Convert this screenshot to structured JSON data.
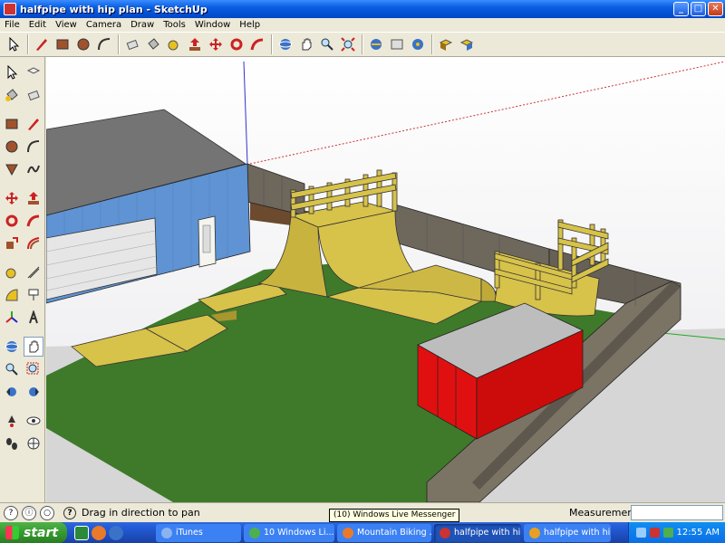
{
  "window": {
    "title": "halfpipe with hip plan - SketchUp",
    "min": "_",
    "max": "□",
    "close": "✕"
  },
  "menu": [
    "File",
    "Edit",
    "View",
    "Camera",
    "Draw",
    "Tools",
    "Window",
    "Help"
  ],
  "toolbar_icons": [
    "select-icon",
    "pencil-icon",
    "rectangle-icon",
    "circle-icon",
    "arc-icon",
    "eraser-icon",
    "paint-bucket-icon",
    "tape-measure-icon",
    "push-pull-icon",
    "move-icon",
    "rotate-icon",
    "follow-me-icon",
    "orbit-icon",
    "pan-icon",
    "zoom-icon",
    "zoom-extents-icon",
    "get-models-icon",
    "share-model-icon",
    "place-model-icon",
    "components-icon",
    "share-component-icon"
  ],
  "status": {
    "hint": "Drag in direction to pan",
    "measurements_label": "Measurements",
    "tooltip": "(10) Windows Live Messenger"
  },
  "taskbar": {
    "start": "start",
    "tasks": [
      {
        "label": "iTunes",
        "color": "#5a8fd8"
      },
      {
        "label": "10 Windows Li...",
        "color": "#4db04d"
      },
      {
        "label": "Mountain Biking ...",
        "color": "#e97a2b"
      },
      {
        "label": "halfpipe with hip...",
        "color": "#c33"
      },
      {
        "label": "halfpipe with hip...",
        "color": "#e8a020"
      }
    ],
    "clock": "12:55 AM"
  },
  "colors": {
    "grass": "#3f7a2a",
    "ramp": "#d7c24a",
    "fence": "#6e675c",
    "house_siding": "#5f93d3",
    "roof": "#777777",
    "container": "#e01010",
    "container_top": "#bdbdbd"
  }
}
